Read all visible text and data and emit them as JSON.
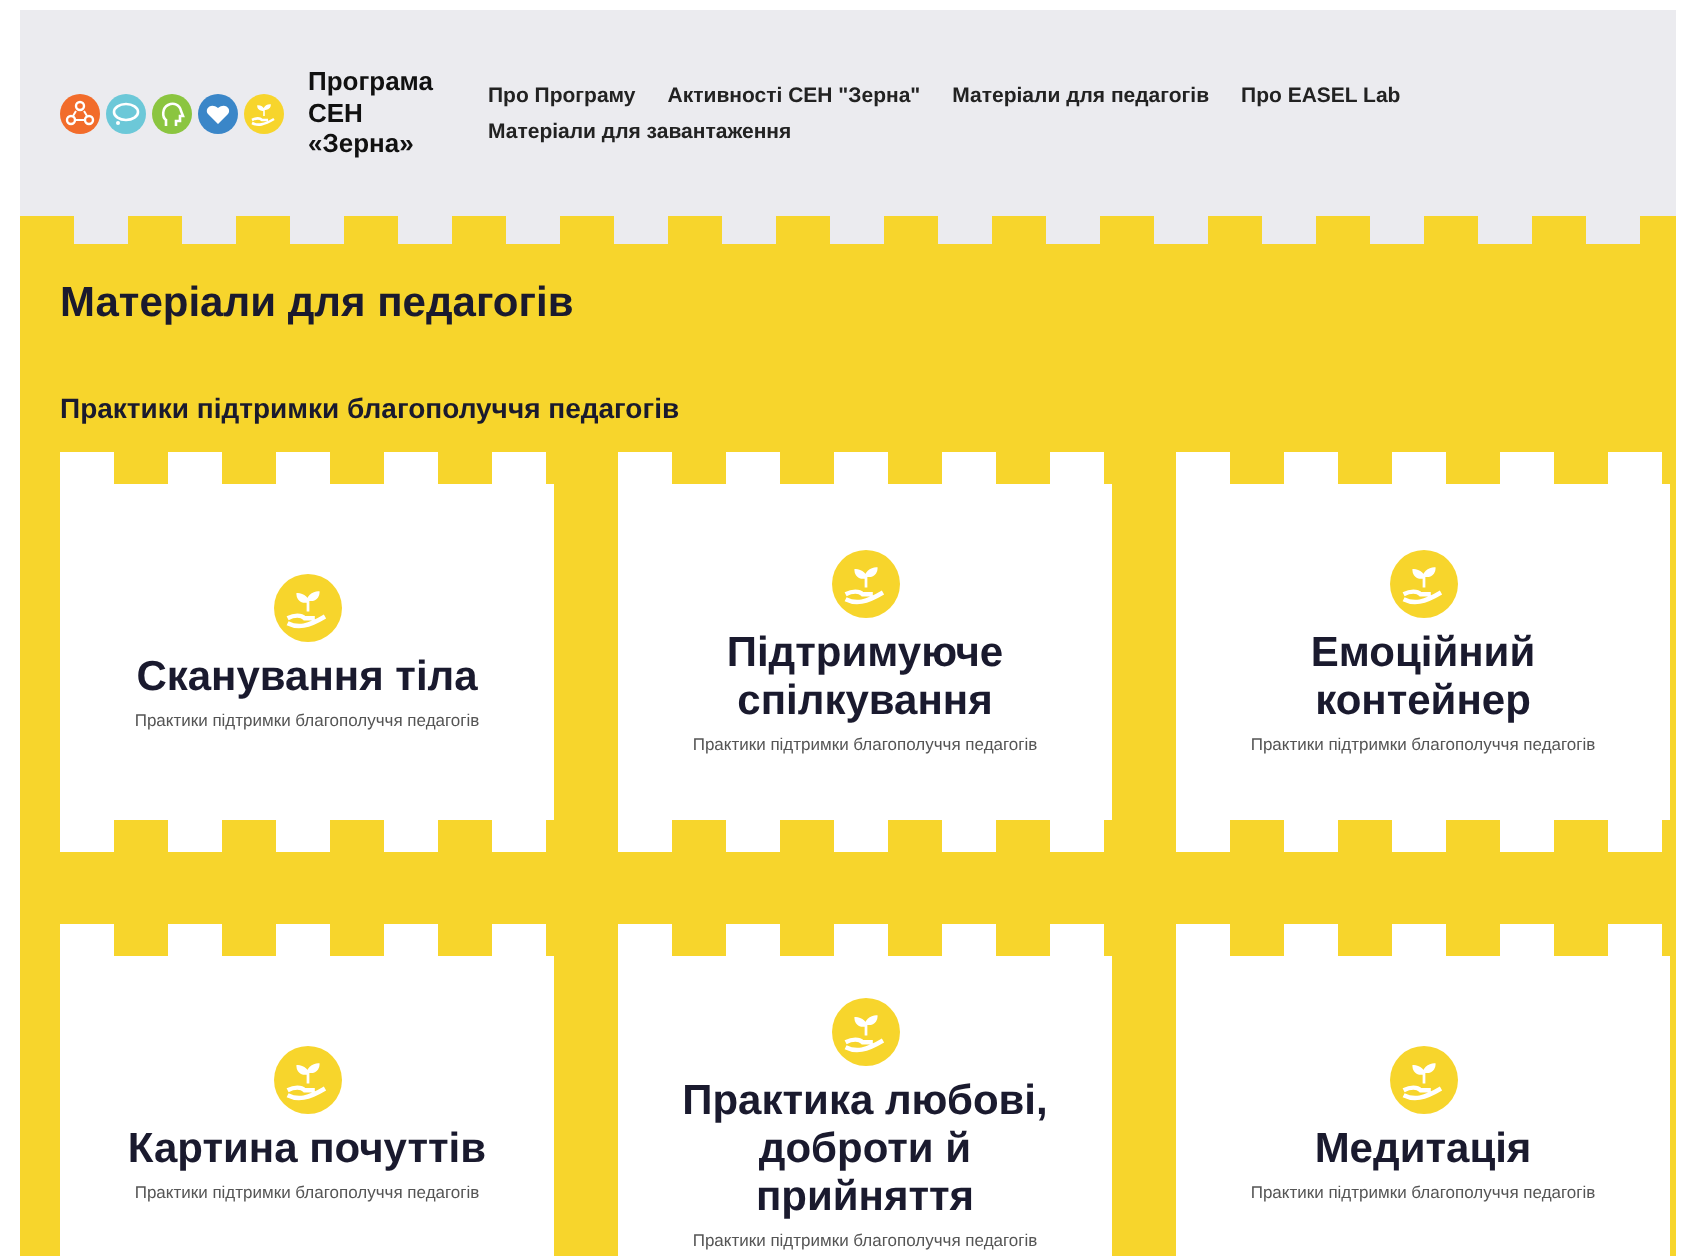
{
  "header": {
    "site_title": "Програма СЕН «Зерна»",
    "nav": [
      {
        "label": "Про Програму"
      },
      {
        "label": "Активності СЕН \"Зерна\""
      },
      {
        "label": "Матеріали для педагогів"
      },
      {
        "label": "Про EASEL Lab"
      },
      {
        "label": "Матеріали для завантаження"
      }
    ]
  },
  "page_title": "Матеріали для педагогів",
  "section_title": "Практики підтримки благополуччя педагогів",
  "cards": [
    {
      "title": "Сканування тіла",
      "subtitle": "Практики підтримки благополуччя педагогів"
    },
    {
      "title": "Підтримуюче спілкування",
      "subtitle": "Практики підтримки благополуччя педагогів"
    },
    {
      "title": "Емоційний контейнер",
      "subtitle": "Практики підтримки благополуччя педагогів"
    },
    {
      "title": "Картина почуттів",
      "subtitle": "Практики підтримки благополуччя педагогів"
    },
    {
      "title": "Практика любові, доброти й прийняття",
      "subtitle": "Практики підтримки благополуччя педагогів"
    },
    {
      "title": "Медитація",
      "subtitle": "Практики підтримки благополуччя педагогів"
    }
  ]
}
